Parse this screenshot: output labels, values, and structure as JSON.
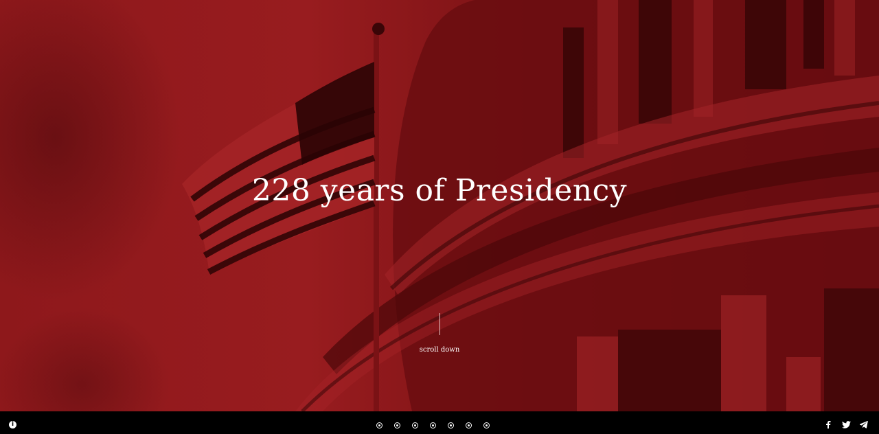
{
  "hero": {
    "headline": "228 years of Presidency",
    "scroll_label": "scroll down"
  },
  "footer": {
    "info_icon": "info-icon",
    "nav_dots_count": 7,
    "social": [
      "facebook-icon",
      "twitter-icon",
      "telegram-icon"
    ]
  },
  "colors": {
    "hero_tint": "#8a1418",
    "footer_bg": "#000000",
    "text": "#ffffff"
  }
}
